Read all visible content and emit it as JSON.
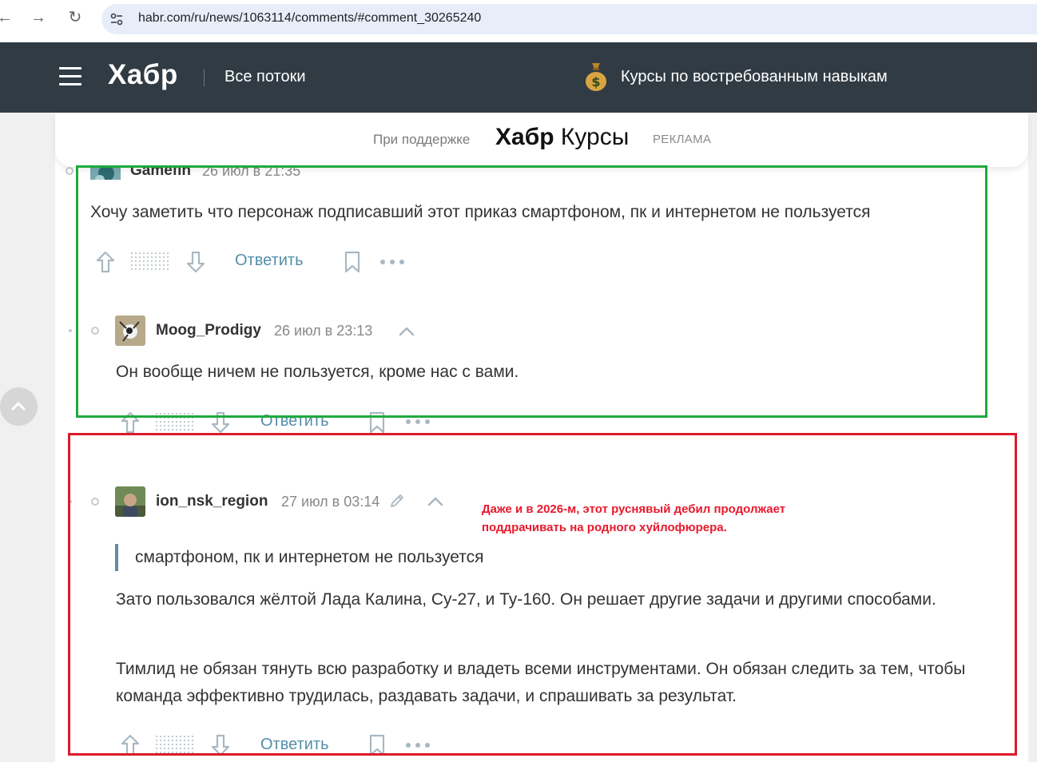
{
  "browser": {
    "url": "habr.com/ru/news/1063114/comments/#comment_30265240"
  },
  "header": {
    "logo": "Хабр",
    "flows_label": "Все потоки",
    "courses_label": "Курсы по востребованным навыкам"
  },
  "sponsor": {
    "support_label": "При поддержке",
    "brand_bold": "Хабр",
    "brand_regular": " Курсы",
    "ad_label": "РЕКЛАМА"
  },
  "comments": [
    {
      "username": "Gamefin",
      "date": "26 июл в 21:35",
      "text": "Хочу заметить что персонаж подписавший этот приказ смартфоном, пк и интернетом не пользуется",
      "reply_label": "Ответить"
    },
    {
      "username": "Moog_Prodigy",
      "date": "26 июл в 23:13",
      "text": "Он вообще ничем не пользуется, кроме нас с вами.",
      "reply_label": "Ответить"
    },
    {
      "username": "ion_nsk_region",
      "date": "27 июл в 03:14",
      "quote": "смартфоном, пк и интернетом не пользуется",
      "paragraph1": "Зато пользовался жёлтой Лада Калина, Су-27, и Ту-160. Он решает другие задачи и другими способами.",
      "paragraph2": "Тимлид не обязан тянуть всю разработку и владеть всеми инструментами. Он обязан следить за тем, чтобы команда эффективно трудилась, раздавать задачи, и спрашивать за результат.",
      "reply_label": "Ответить"
    }
  ],
  "annotation": {
    "line1": "Даже и в 2026-м, этот руснявый дебил продолжает",
    "line2": "поддрачивать на родного хуйлофюрера."
  },
  "colors": {
    "header_bg": "#303b44",
    "link": "#548eaa",
    "frame_green": "#1faa3e",
    "frame_red": "#dd1a2a",
    "annotation_text": "#e8192c"
  }
}
